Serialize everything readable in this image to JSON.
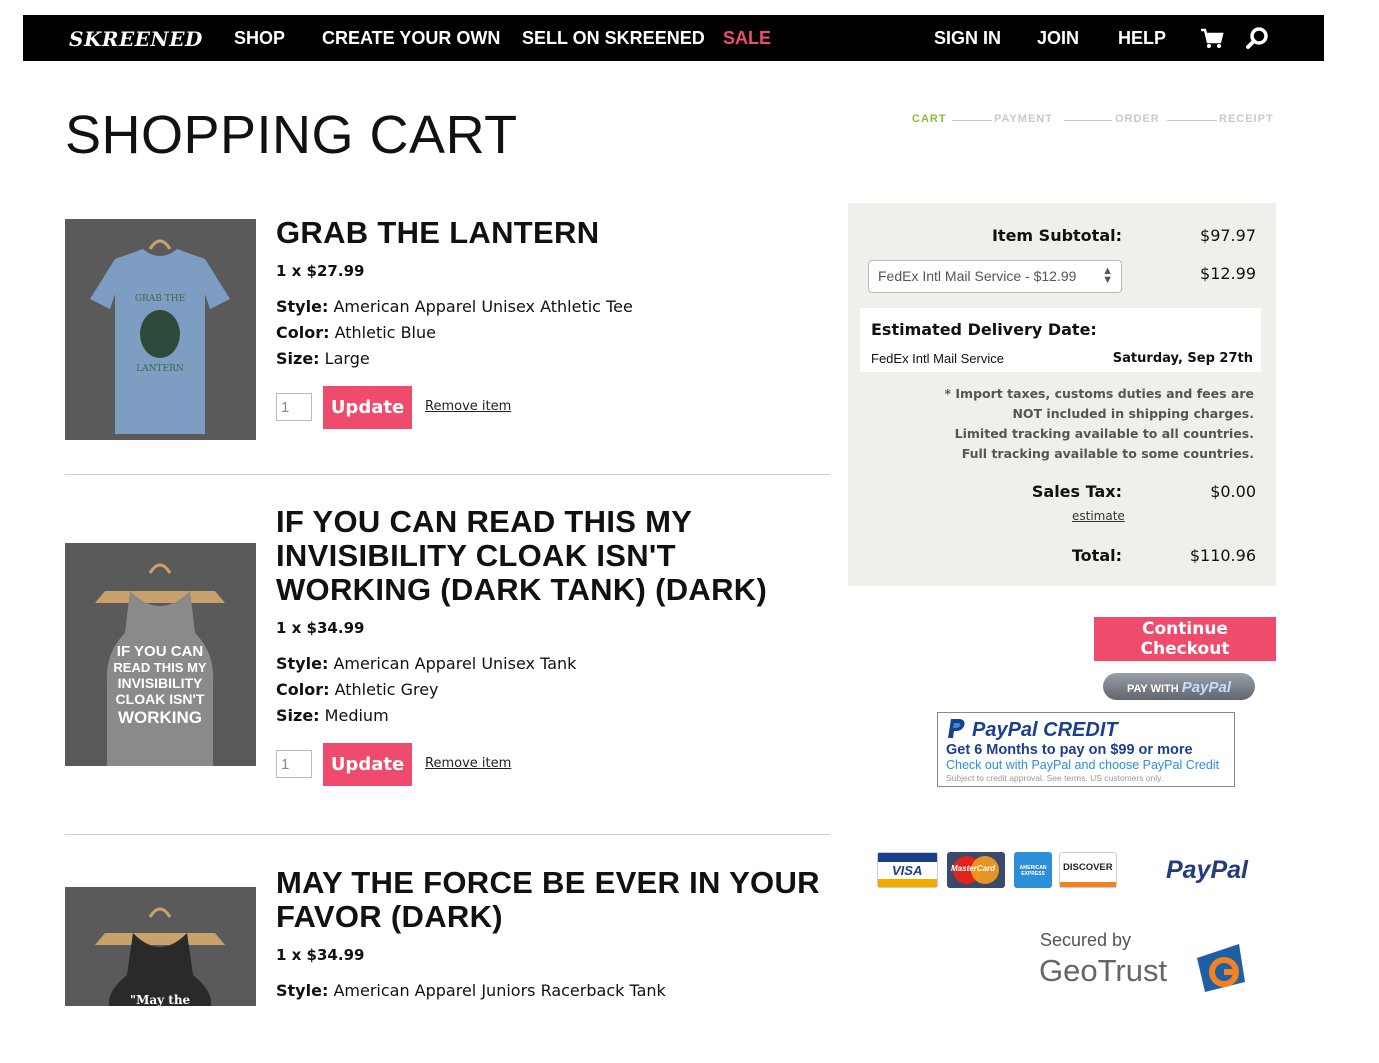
{
  "nav": {
    "logo": "SKREENED",
    "links": [
      "SHOP",
      "CREATE YOUR OWN",
      "SELL ON SKREENED",
      "SALE"
    ],
    "right_links": [
      "SIGN IN",
      "JOIN",
      "HELP"
    ],
    "sale_color": "#ef4b6c",
    "icons": [
      "cart-icon",
      "search-icon"
    ]
  },
  "page_title": "SHOPPING CART",
  "steps": [
    "CART",
    "PAYMENT",
    "ORDER",
    "RECEIPT"
  ],
  "items": [
    {
      "title": "GRAB THE LANTERN",
      "price": "1 x $27.99",
      "style_label": "Style:",
      "style": "American Apparel Unisex Athletic Tee",
      "color_label": "Color:",
      "color": "Athletic Blue",
      "size_label": "Size:",
      "size": "Large",
      "qty": "1",
      "update": "Update",
      "remove": "Remove item",
      "shirt_color": "#7e9dc2",
      "image_text": [
        "GRAB THE",
        "LANTERN"
      ]
    },
    {
      "title": "IF YOU CAN READ THIS MY INVISIBILITY CLOAK ISN'T WORKING (DARK TANK) (DARK)",
      "price": "1 x $34.99",
      "style_label": "Style:",
      "style": "American Apparel Unisex Tank",
      "color_label": "Color:",
      "color": "Athletic Grey",
      "size_label": "Size:",
      "size": "Medium",
      "qty": "1",
      "update": "Update",
      "remove": "Remove item",
      "shirt_color": "#8a8a8a",
      "image_text": [
        "IF YOU CAN",
        "READ THIS MY",
        "INVISIBILITY",
        "CLOAK ISN'T",
        "WORKING"
      ]
    },
    {
      "title": "MAY THE FORCE BE EVER IN YOUR FAVOR (DARK)",
      "price": "1 x $34.99",
      "style_label": "Style:",
      "style": "American Apparel Juniors Racerback Tank",
      "shirt_color": "#2a2a2a",
      "image_text": [
        "\"May the"
      ]
    }
  ],
  "summary": {
    "subtotal_label": "Item Subtotal:",
    "subtotal": "$97.97",
    "shipping_option": "FedEx Intl Mail Service - $12.99",
    "shipping_cost": "$12.99",
    "delivery_title": "Estimated Delivery Date:",
    "delivery_service": "FedEx Intl Mail Service",
    "delivery_date": "Saturday, Sep 27th",
    "notes": [
      "* Import taxes, customs duties and fees are",
      "NOT included in shipping charges.",
      "Limited tracking available to all countries.",
      "Full tracking available to some countries."
    ],
    "tax_label": "Sales Tax:",
    "tax": "$0.00",
    "estimate": "estimate",
    "total_label": "Total:",
    "total": "$110.96"
  },
  "checkout": "Continue Checkout",
  "paywith": {
    "prefix": "PAY WITH",
    "brand": "PayPal"
  },
  "paypal_credit": {
    "title": "PayPal CREDIT",
    "line1": "Get 6 Months to pay on $99 or more",
    "line2": "Check out with PayPal and choose PayPal Credit",
    "line3": "Subject to credit approval. See terms. US customers only."
  },
  "cards": [
    "VISA",
    "MasterCard",
    "AMERICAN EXPRESS",
    "DISCOVER"
  ],
  "paypal_logo": "PayPal",
  "secured_by": "Secured by",
  "geotrust": "GeoTrust"
}
